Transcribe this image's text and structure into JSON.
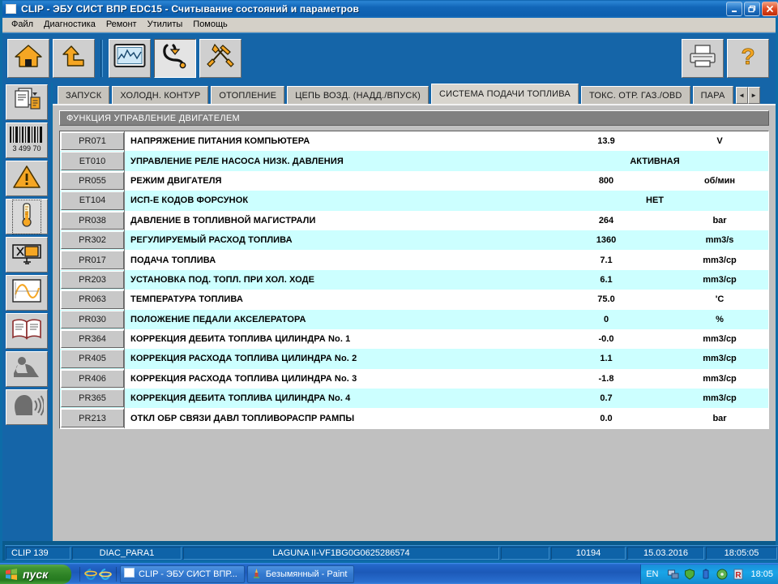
{
  "window": {
    "title": "CLIP - ЭБУ СИСТ ВПР EDC15 - Считывание состояний и параметров",
    "minimize_label": "_",
    "restore_label": "❐",
    "close_label": "✕"
  },
  "menu": {
    "items": [
      "Файл",
      "Диагностика",
      "Ремонт",
      "Утилиты",
      "Помощь"
    ]
  },
  "toolbar": {
    "buttons": [
      {
        "name": "home-icon",
        "tooltip": "Домой"
      },
      {
        "name": "up-arrow-icon",
        "tooltip": "Назад"
      },
      {
        "name": "chart-monitor-icon",
        "tooltip": "Параметры"
      },
      {
        "name": "stethoscope-icon",
        "tooltip": "Диагностика"
      },
      {
        "name": "tools-icon",
        "tooltip": "Инструменты"
      }
    ],
    "right_buttons": [
      {
        "name": "printer-icon",
        "tooltip": "Печать"
      },
      {
        "name": "help-question-icon",
        "tooltip": "Помощь"
      }
    ]
  },
  "sidebar": {
    "items": [
      {
        "name": "documents-icon",
        "label": "Документы"
      },
      {
        "name": "barcode-icon",
        "label": "3 499 70"
      },
      {
        "name": "warning-triangle-icon",
        "label": "Неисправности"
      },
      {
        "name": "thermometer-icon",
        "label": "Параметры",
        "selected": true
      },
      {
        "name": "relay-valve-icon",
        "label": "Исполнительные"
      },
      {
        "name": "graph-curve-icon",
        "label": "График"
      },
      {
        "name": "book-icon",
        "label": "Документация"
      },
      {
        "name": "seat-person-icon",
        "label": "Подушка"
      },
      {
        "name": "speaking-head-icon",
        "label": "Сообщения"
      }
    ],
    "barcode_number": "3 499 70"
  },
  "tabs": {
    "items": [
      {
        "label": "ЗАПУСК",
        "active": false
      },
      {
        "label": "ХОЛОДН. КОНТУР",
        "active": false
      },
      {
        "label": "ОТОПЛЕНИЕ",
        "active": false
      },
      {
        "label": "ЦЕПЬ ВОЗД. (НАДД./ВПУСК)",
        "active": false
      },
      {
        "label": "СИСТЕМА ПОДАЧИ ТОПЛИВА",
        "active": true
      },
      {
        "label": "ТОКС. ОТР. ГАЗ./OBD",
        "active": false
      },
      {
        "label": "ПАРА",
        "active": false
      }
    ],
    "scroll_left": "◄",
    "scroll_right": "►"
  },
  "section": {
    "header": "ФУНКЦИЯ УПРАВЛЕНИЕ ДВИГАТЕЛЕМ"
  },
  "table": {
    "rows": [
      {
        "code": "PR071",
        "label": "НАПРЯЖЕНИЕ ПИТАНИЯ КОМПЬЮТЕРА",
        "value": "13.9",
        "unit": "V",
        "state": ""
      },
      {
        "code": "ET010",
        "label": "УПРАВЛЕНИЕ РЕЛЕ НАСОСА НИЗК. ДАВЛЕНИЯ",
        "value": "",
        "unit": "",
        "state": "АКТИВНАЯ"
      },
      {
        "code": "PR055",
        "label": "РЕЖИМ ДВИГАТЕЛЯ",
        "value": "800",
        "unit": "об/мин",
        "state": ""
      },
      {
        "code": "ET104",
        "label": "ИСП-Е КОДОВ ФОРСУНОК",
        "value": "",
        "unit": "",
        "state": "НЕТ"
      },
      {
        "code": "PR038",
        "label": "ДАВЛЕНИЕ В ТОПЛИВНОЙ МАГИСТРАЛИ",
        "value": "264",
        "unit": "bar",
        "state": ""
      },
      {
        "code": "PR302",
        "label": "РЕГУЛИРУЕМЫЙ РАСХОД ТОПЛИВА",
        "value": "1360",
        "unit": "mm3/s",
        "state": ""
      },
      {
        "code": "PR017",
        "label": "ПОДАЧА ТОПЛИВА",
        "value": "7.1",
        "unit": "mm3/cp",
        "state": ""
      },
      {
        "code": "PR203",
        "label": "УСТАНОВКА ПОД. ТОПЛ. ПРИ ХОЛ. ХОДЕ",
        "value": "6.1",
        "unit": "mm3/cp",
        "state": ""
      },
      {
        "code": "PR063",
        "label": "ТЕМПЕРАТУРА ТОПЛИВА",
        "value": "75.0",
        "unit": "'C",
        "state": ""
      },
      {
        "code": "PR030",
        "label": "ПОЛОЖЕНИЕ ПЕДАЛИ АКСЕЛЕРАТОРА",
        "value": "0",
        "unit": "%",
        "state": ""
      },
      {
        "code": "PR364",
        "label": "КОРРЕКЦИЯ ДЕБИТА ТОПЛИВА ЦИЛИНДРА No. 1",
        "value": "-0.0",
        "unit": "mm3/cp",
        "state": ""
      },
      {
        "code": "PR405",
        "label": "КОРРЕКЦИЯ РАСХОДА ТОПЛИВА ЦИЛИНДРА No. 2",
        "value": "1.1",
        "unit": "mm3/cp",
        "state": ""
      },
      {
        "code": "PR406",
        "label": "КОРРЕКЦИЯ РАСХОДА ТОПЛИВА ЦИЛИНДРА No. 3",
        "value": "-1.8",
        "unit": "mm3/cp",
        "state": ""
      },
      {
        "code": "PR365",
        "label": "КОРРЕКЦИЯ ДЕБИТА ТОПЛИВА ЦИЛИНДРА No. 4",
        "value": "0.7",
        "unit": "mm3/cp",
        "state": ""
      },
      {
        "code": "PR213",
        "label": "ОТКЛ ОБР СВЯЗИ ДАВЛ ТОПЛИВОРАСПР РАМПЫ",
        "value": "0.0",
        "unit": "bar",
        "state": ""
      }
    ]
  },
  "status_bar": {
    "app_version": "CLIP 139",
    "session": "DIAC_PARA1",
    "vehicle": "LAGUNA II-VF1BG0G0625286574",
    "counter": "10194",
    "date": "15.03.2016",
    "time": "18:05:05"
  },
  "taskbar": {
    "start_label": "пуск",
    "quick_launch": [
      {
        "name": "internet-explorer-icon"
      },
      {
        "name": "browser-e-icon"
      }
    ],
    "tasks": [
      {
        "name": "clip-task",
        "label": "CLIP - ЭБУ СИСТ ВПР...",
        "icon": "window-icon",
        "active": true
      },
      {
        "name": "paint-task",
        "label": "Безымянный - Paint",
        "icon": "paint-icon",
        "active": false
      }
    ],
    "tray": {
      "language": "EN",
      "icons": [
        "network-icon",
        "shield-icon",
        "battery-icon",
        "disc-icon",
        "alert-icon"
      ],
      "clock": "18:05"
    }
  },
  "colors": {
    "title_bar": "#1266b8",
    "toolbar": "#1565a8",
    "row_alt": "#ccffff",
    "accent_orange": "#f5a623",
    "panel_gray": "#c0c0c0"
  }
}
